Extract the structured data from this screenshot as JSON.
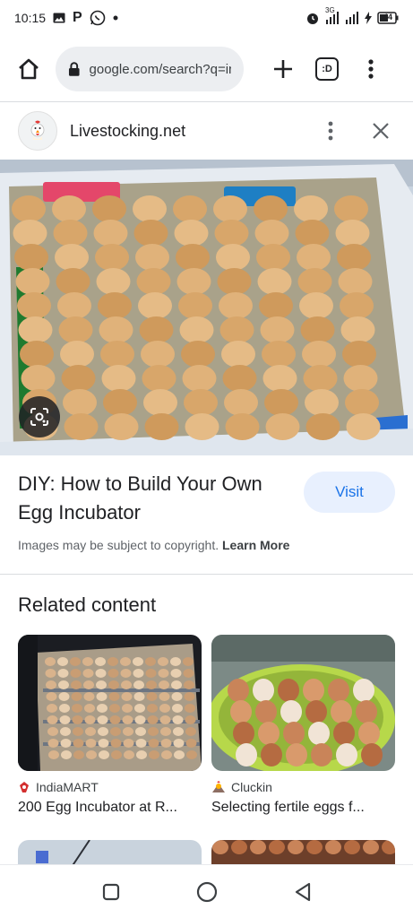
{
  "status_bar": {
    "time": "10:15",
    "network": "3G",
    "battery": "44"
  },
  "browser": {
    "url": "google.com/search?q=in",
    "tab_count": ":D"
  },
  "site": {
    "name": "Livestocking.net"
  },
  "result": {
    "title": "DIY: How to Build Your Own Egg Incubator",
    "visit_label": "Visit",
    "copyright_text": "Images may be subject to copyright.",
    "learn_more_label": "Learn More"
  },
  "related": {
    "heading": "Related content",
    "cards": [
      {
        "source": "IndiaMART",
        "title": "200 Egg Incubator at R..."
      },
      {
        "source": "Cluckin",
        "title": "Selecting fertile eggs f..."
      }
    ]
  },
  "colors": {
    "accent": "#1a73e8",
    "visit_bg": "#e8f0fe",
    "url_bg": "#eceef1"
  },
  "icons": {
    "home": "home-icon",
    "lock": "lock-icon",
    "plus": "plus-icon",
    "tabs": "tab-switcher-icon",
    "menu": "more-vert-icon",
    "close": "close-icon",
    "lens": "google-lens-icon"
  }
}
